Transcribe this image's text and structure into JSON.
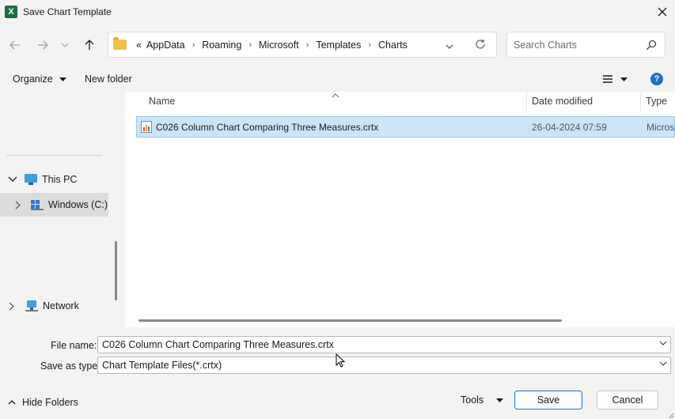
{
  "window": {
    "title": "Save Chart Template",
    "app_icon_letter": "X"
  },
  "address": {
    "overflow": "«",
    "crumbs": [
      "AppData",
      "Roaming",
      "Microsoft",
      "Templates",
      "Charts"
    ]
  },
  "search": {
    "placeholder": "Search Charts"
  },
  "commands": {
    "organize": "Organize",
    "new_folder": "New folder",
    "help": "?"
  },
  "nav": {
    "this_pc": "This PC",
    "windows_c": "Windows (C:)",
    "network": "Network"
  },
  "list": {
    "columns": {
      "name": "Name",
      "date": "Date modified",
      "type": "Type"
    },
    "rows": [
      {
        "name": "C026 Column Chart Comparing Three Measures.crtx",
        "date": "26-04-2024 07:59",
        "type": "Micros"
      }
    ]
  },
  "form": {
    "file_name_label": "File name:",
    "file_name_value": "C026 Column Chart Comparing Three Measures.crtx",
    "save_type_label": "Save as type:",
    "save_type_value": "Chart Template Files(*.crtx)"
  },
  "footer": {
    "hide_folders": "Hide Folders",
    "tools": "Tools",
    "save": "Save",
    "cancel": "Cancel"
  },
  "colors": {
    "accent": "#1a73c8",
    "selection": "#cce4f7",
    "excel_green": "#1d6f42"
  }
}
